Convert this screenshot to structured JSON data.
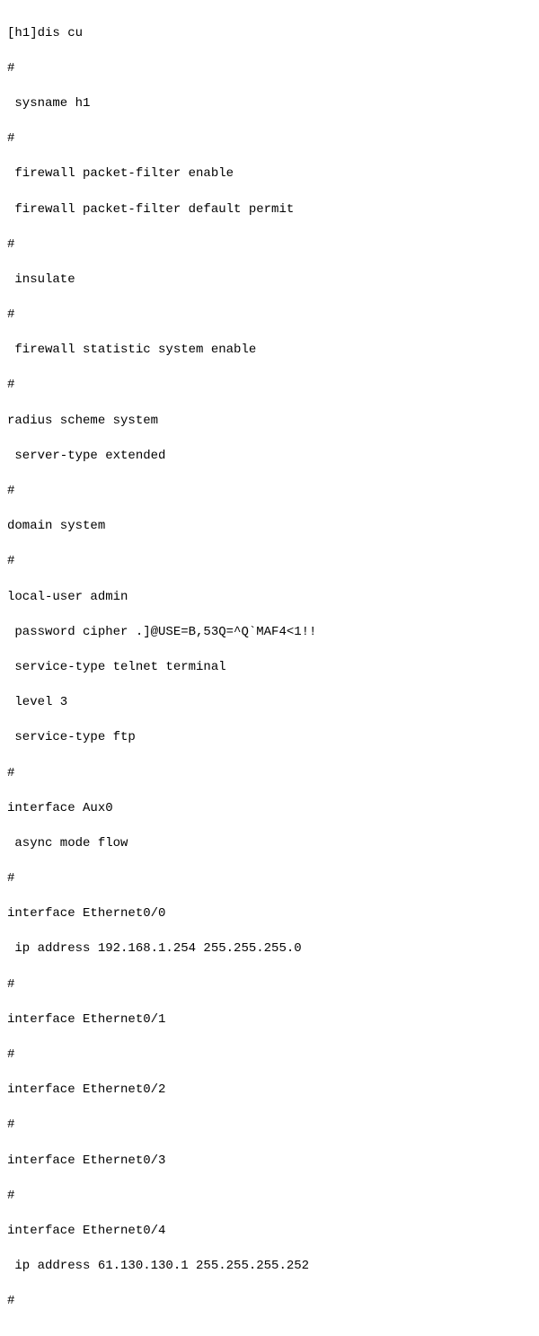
{
  "terminal": {
    "lines": [
      "[h1]dis cu",
      "#",
      " sysname h1",
      "#",
      " firewall packet-filter enable",
      " firewall packet-filter default permit",
      "#",
      " insulate",
      "#",
      " firewall statistic system enable",
      "#",
      "radius scheme system",
      " server-type extended",
      "#",
      "domain system",
      "#",
      "local-user admin",
      " password cipher .]@USE=B,53Q=^Q`MAF4<1!!",
      " service-type telnet terminal",
      " level 3",
      " service-type ftp",
      "#",
      "interface Aux0",
      " async mode flow",
      "#",
      "interface Ethernet0/0",
      " ip address 192.168.1.254 255.255.255.0",
      "#",
      "interface Ethernet0/1",
      "#",
      "interface Ethernet0/2",
      "#",
      "interface Ethernet0/3",
      "#",
      "interface Ethernet0/4",
      " ip address 61.130.130.1 255.255.255.252",
      "#"
    ]
  }
}
